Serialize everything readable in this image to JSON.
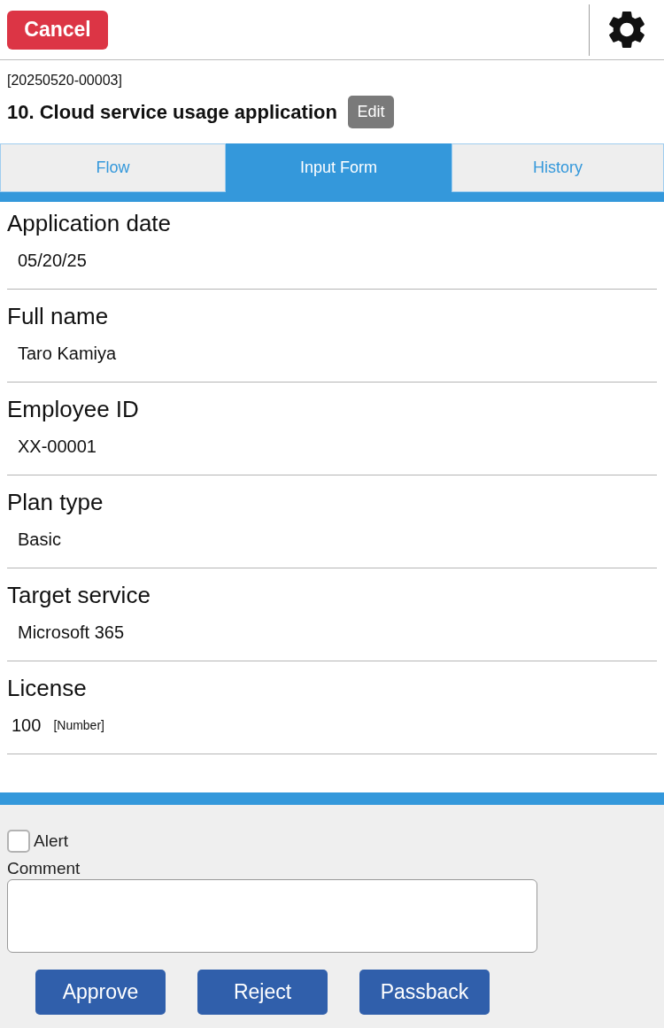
{
  "header": {
    "cancel_button": "Cancel"
  },
  "document": {
    "number": "[20250520-00003]",
    "title": "10. Cloud service usage application",
    "edit_button": "Edit"
  },
  "tabs": [
    {
      "label": "Flow",
      "selected": false
    },
    {
      "label": "Input Form",
      "selected": true
    },
    {
      "label": "History",
      "selected": false
    }
  ],
  "fields": [
    {
      "label": "Application date",
      "value": "05/20/25"
    },
    {
      "label": "Full name",
      "value": "Taro Kamiya"
    },
    {
      "label": "Employee ID",
      "value": "XX-00001"
    },
    {
      "label": "Plan type",
      "value": "Basic"
    },
    {
      "label": "Target service",
      "value": "Microsoft 365"
    },
    {
      "label": "License",
      "value": "100",
      "unit": "[Number]"
    }
  ],
  "footer": {
    "alert": {
      "label": "Alert",
      "checked": false
    },
    "comment": {
      "label": "Comment"
    },
    "buttons": [
      "Approve",
      "Reject",
      "Passback"
    ]
  }
}
